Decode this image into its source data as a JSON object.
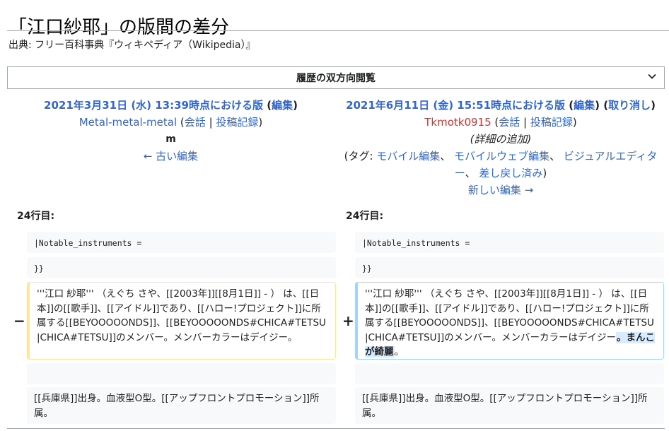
{
  "page": {
    "title": "「江口紗耶」の版間の差分",
    "source": "出典: フリー百科事典『ウィキペディア（Wikipedia）』"
  },
  "nav": {
    "label": "履歴の双方向閲覧"
  },
  "left_rev": {
    "heading": "2021年3月31日 (水) 13:39時点における版",
    "open_paren": " (",
    "edit": "編集",
    "close_paren": ")",
    "user": "Metal-metal-metal",
    "talk": "会話",
    "contribs": "投稿記録",
    "pipe": " | ",
    "minor": "m",
    "older": "← 古い編集"
  },
  "right_rev": {
    "heading": "2021年6月11日 (金) 15:51時点における版",
    "open_paren": " (",
    "edit": "編集",
    "close_paren": ")",
    "undo": "取り消し",
    "user": "Tkmotk0915",
    "talk": "会話",
    "contribs": "投稿記録",
    "pipe": " | ",
    "summary": "(詳細の追加)",
    "tags_prefix": "(タグ: ",
    "tag1": "モバイル編集",
    "tag2": "モバイルウェブ編集",
    "tag3": "ビジュアルエディター",
    "tag4": "差し戻し済み",
    "tags_sep": "、 ",
    "tags_suffix": ")",
    "newer": "新しい編集 →"
  },
  "diff": {
    "left_line": "24行目:",
    "right_line": "24行目:",
    "minus": "−",
    "plus": "+",
    "context1": "|Notable_instruments =",
    "context2": "}}",
    "old_text": "'''江口 紗耶''' （えぐち さや、[[2003年]][[8月1日]] - ） は、[[日本]]の[[歌手]]、[[アイドル]]であり、[[ハロー!プロジェクト]]に所属する[[BEYOOOOONDS]]、[[BEYOOOOONDS#CHICA#TETSU|CHICA#TETSU]]のメンバー。メンバーカラーはデイジー。",
    "new_text": "'''江口 紗耶''' （えぐち さや、[[2003年]][[8月1日]] - ） は、[[日本]]の[[歌手]]、[[アイドル]]であり、[[ハロー!プロジェクト]]に所属する[[BEYOOOOONDS]]、[[BEYOOOOONDS#CHICA#TETSU|CHICA#TETSU]]のメンバー。メンバーカラーはデイジー",
    "new_inserted": "。まんこが綺麗",
    "new_tail": "。",
    "context3": "[[兵庫県]]出身。血液型O型。[[アップフロントプロモーション]]所属。"
  },
  "colors": {
    "link": "#3366cc",
    "red_link": "#d73333",
    "deleted_border": "#ffe49c",
    "added_border": "#a3d3ff",
    "inserted_bg": "#d8ecff"
  }
}
